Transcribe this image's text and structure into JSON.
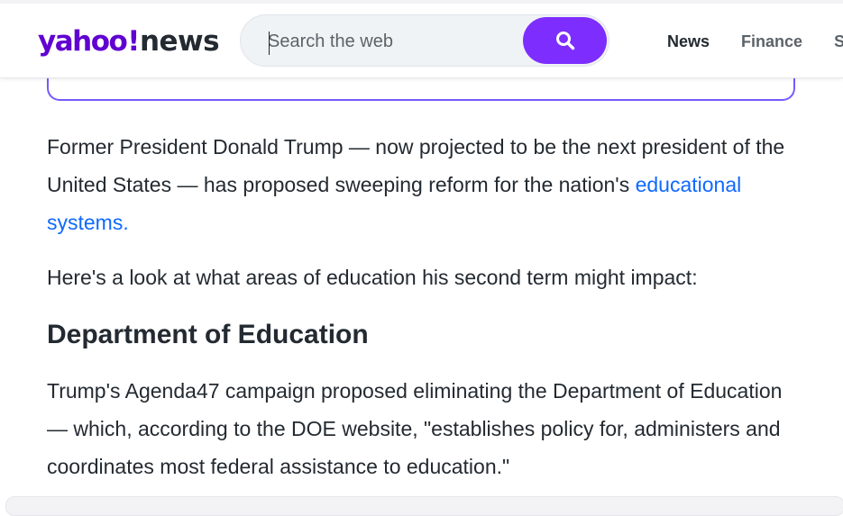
{
  "header": {
    "logo": {
      "brand": "yahoo",
      "bang": "!",
      "section": "news"
    },
    "search": {
      "placeholder": "Search the web",
      "value": ""
    },
    "nav": [
      {
        "label": "News",
        "active": true
      },
      {
        "label": "Finance",
        "active": false
      },
      {
        "label": "S",
        "active": false
      }
    ]
  },
  "article": {
    "p1_text": "Former President Donald Trump — now projected to be the next president of the United States — has proposed sweeping reform for the nation's ",
    "p1_link": "educational systems.",
    "p2": "Here's a look at what areas of education his second term might impact:",
    "heading": "Department of Education",
    "p3": "Trump's Agenda47 campaign proposed eliminating the Department of Education — which, according to the DOE website, \"establishes policy for, administers and coordinates most federal assistance to education.\""
  },
  "colors": {
    "brand_purple": "#6001d2",
    "search_button": "#7d2eff",
    "link_blue": "#0f69ff",
    "box_border": "#7759ff",
    "text": "#232a31"
  },
  "icons": {
    "search": "search-icon"
  }
}
